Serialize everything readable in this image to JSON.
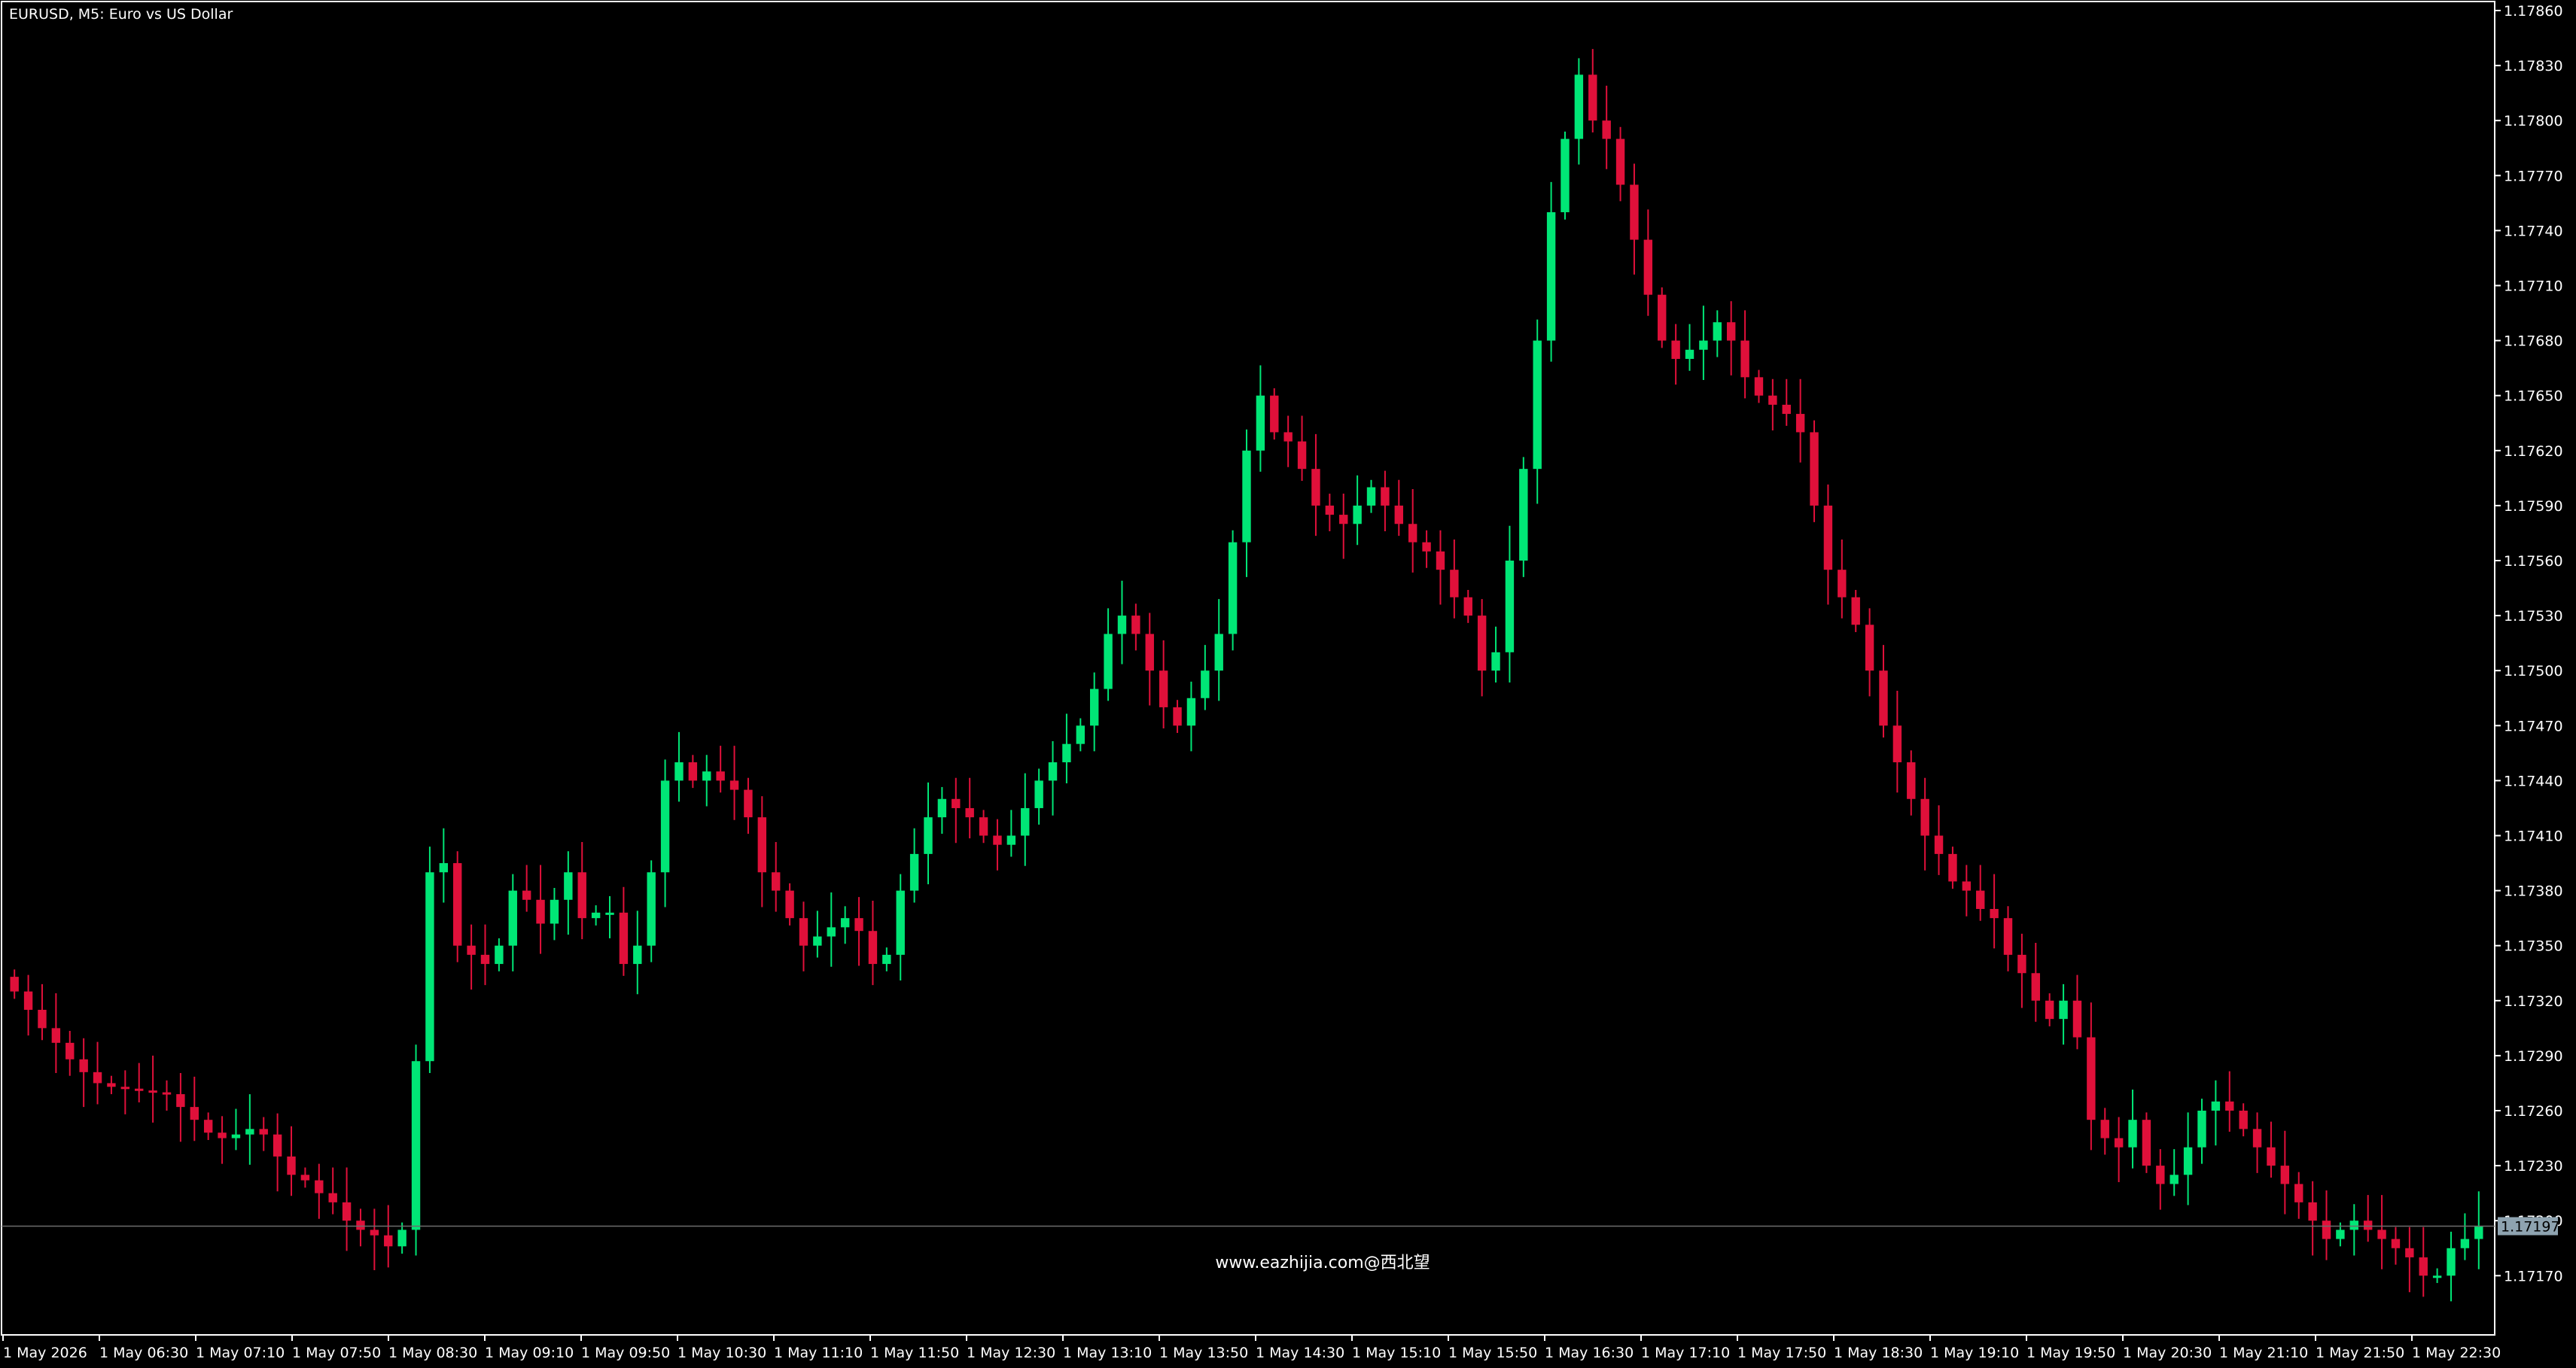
{
  "window": {
    "title": "EURUSD, M5:  Euro vs US Dollar"
  },
  "watermark": "www.eazhijia.com@西北望",
  "colors": {
    "background": "#000000",
    "bull": "#00e676",
    "bear": "#e0103a",
    "axis": "#ffffff",
    "bid_line": "#6d6d6d",
    "price_box": "#8ea3b0"
  },
  "chart_data": {
    "type": "candlestick",
    "symbol": "EURUSD",
    "timeframe": "M5",
    "ylim": [
      1.1715,
      1.1787
    ],
    "y_ticks": [
      "1.17860",
      "1.17830",
      "1.17800",
      "1.17770",
      "1.17740",
      "1.17710",
      "1.17680",
      "1.17650",
      "1.17620",
      "1.17590",
      "1.17560",
      "1.17530",
      "1.17500",
      "1.17470",
      "1.17440",
      "1.17410",
      "1.17380",
      "1.17350",
      "1.17320",
      "1.17290",
      "1.17260",
      "1.17230",
      "1.17200",
      "1.17170"
    ],
    "x_ticks": [
      "1 May 2026",
      "1 May 06:30",
      "1 May 07:10",
      "1 May 07:50",
      "1 May 08:30",
      "1 May 09:10",
      "1 May 09:50",
      "1 May 10:30",
      "1 May 11:10",
      "1 May 11:50",
      "1 May 12:30",
      "1 May 13:10",
      "1 May 13:50",
      "1 May 14:30",
      "1 May 15:10",
      "1 May 15:50",
      "1 May 16:30",
      "1 May 17:10",
      "1 May 17:50",
      "1 May 18:30",
      "1 May 19:10",
      "1 May 19:50",
      "1 May 20:30",
      "1 May 21:10",
      "1 May 21:50",
      "1 May 22:30"
    ],
    "current_price": "1.17197",
    "close_series": [
      1.17325,
      1.17315,
      1.17305,
      1.17297,
      1.17288,
      1.17281,
      1.17275,
      1.17273,
      1.17272,
      1.17271,
      1.1727,
      1.17269,
      1.17262,
      1.17255,
      1.17248,
      1.17245,
      1.17247,
      1.1725,
      1.17247,
      1.17235,
      1.17225,
      1.17222,
      1.17215,
      1.1721,
      1.172,
      1.17195,
      1.17192,
      1.17186,
      1.17195,
      1.17287,
      1.1739,
      1.17395,
      1.1735,
      1.17345,
      1.1734,
      1.1735,
      1.1738,
      1.17375,
      1.17362,
      1.17375,
      1.1739,
      1.17365,
      1.17368,
      1.17368,
      1.1734,
      1.1735,
      1.1739,
      1.1744,
      1.1745,
      1.1744,
      1.17445,
      1.1744,
      1.17435,
      1.1742,
      1.1739,
      1.1738,
      1.17365,
      1.1735,
      1.17355,
      1.1736,
      1.17365,
      1.17358,
      1.1734,
      1.17345,
      1.1738,
      1.174,
      1.1742,
      1.1743,
      1.17425,
      1.1742,
      1.1741,
      1.17405,
      1.1741,
      1.17425,
      1.1744,
      1.1745,
      1.1746,
      1.1747,
      1.1749,
      1.1752,
      1.1753,
      1.1752,
      1.175,
      1.1748,
      1.1747,
      1.17485,
      1.175,
      1.1752,
      1.1757,
      1.1762,
      1.1765,
      1.1763,
      1.17625,
      1.1761,
      1.1759,
      1.17585,
      1.1758,
      1.1759,
      1.176,
      1.1759,
      1.1758,
      1.1757,
      1.17565,
      1.17555,
      1.1754,
      1.1753,
      1.175,
      1.1751,
      1.1756,
      1.1761,
      1.1768,
      1.1775,
      1.1779,
      1.17825,
      1.178,
      1.1779,
      1.17765,
      1.17735,
      1.17705,
      1.1768,
      1.1767,
      1.17675,
      1.1768,
      1.1769,
      1.1768,
      1.1766,
      1.1765,
      1.17645,
      1.1764,
      1.1763,
      1.1759,
      1.17555,
      1.1754,
      1.17525,
      1.175,
      1.1747,
      1.1745,
      1.1743,
      1.1741,
      1.174,
      1.17385,
      1.1738,
      1.1737,
      1.17365,
      1.17345,
      1.17335,
      1.1732,
      1.1731,
      1.1732,
      1.173,
      1.17255,
      1.17245,
      1.1724,
      1.17255,
      1.1723,
      1.1722,
      1.17225,
      1.1724,
      1.1726,
      1.17265,
      1.1726,
      1.1725,
      1.1724,
      1.1723,
      1.1722,
      1.1721,
      1.172,
      1.1719,
      1.17195,
      1.172,
      1.17195,
      1.1719,
      1.17185,
      1.1718,
      1.1717,
      1.1717,
      1.17185,
      1.1719,
      1.17197
    ]
  }
}
